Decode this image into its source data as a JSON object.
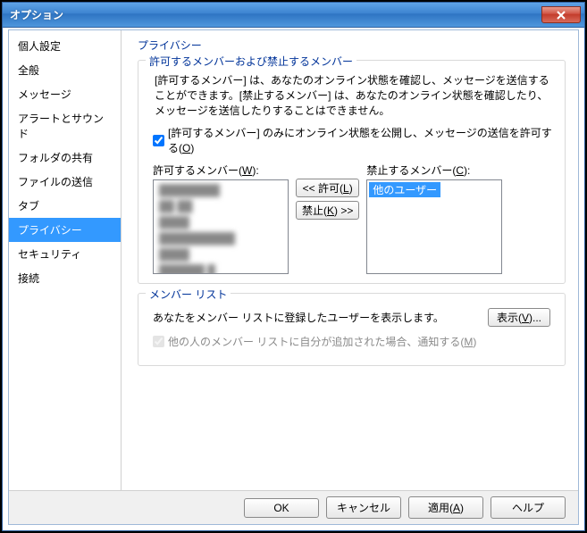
{
  "window": {
    "title": "オプション"
  },
  "sidebar": {
    "items": [
      {
        "label": "個人設定"
      },
      {
        "label": "全般"
      },
      {
        "label": "メッセージ"
      },
      {
        "label": "アラートとサウンド"
      },
      {
        "label": "フォルダの共有"
      },
      {
        "label": "ファイルの送信"
      },
      {
        "label": "タブ"
      },
      {
        "label": "プライバシー",
        "selected": true
      },
      {
        "label": "セキュリティ"
      },
      {
        "label": "接続"
      }
    ]
  },
  "content": {
    "page_title": "プライバシー",
    "group_allow": {
      "legend": "許可するメンバーおよび禁止するメンバー",
      "desc": "[許可するメンバー] は、あなたのオンライン状態を確認し、メッセージを送信することができます。[禁止するメンバー] は、あなたのオンライン状態を確認したり、メッセージを送信したりすることはできません。",
      "only_allow_label_a": "[許可するメンバー] のみにオンライン状態を公開し、メッセージの送信を許可する(",
      "only_allow_accel": "O",
      "only_allow_label_b": ")",
      "only_allow_checked": true,
      "allow_list_label_a": "許可するメンバー(",
      "allow_list_accel": "W",
      "allow_list_label_b": "):",
      "block_list_label_a": "禁止するメンバー(",
      "block_list_accel": "C",
      "block_list_label_b": "):",
      "btn_allow_a": "<< 許可(",
      "btn_allow_accel": "L",
      "btn_allow_b": ")",
      "btn_block_a": "禁止(",
      "btn_block_accel": "K",
      "btn_block_b": ") >>",
      "block_selected_item": "他のユーザー"
    },
    "group_member": {
      "legend": "メンバー リスト",
      "desc": "あなたをメンバー リストに登録したユーザーを表示します。",
      "btn_show_a": "表示(",
      "btn_show_accel": "V",
      "btn_show_b": ")...",
      "notify_label_a": "他の人のメンバー リストに自分が追加された場合、通知する(",
      "notify_accel": "M",
      "notify_label_b": ")",
      "notify_checked": true,
      "notify_disabled": true
    }
  },
  "footer": {
    "ok": "OK",
    "cancel": "キャンセル",
    "apply_a": "適用(",
    "apply_accel": "A",
    "apply_b": ")",
    "help": "ヘルプ"
  }
}
